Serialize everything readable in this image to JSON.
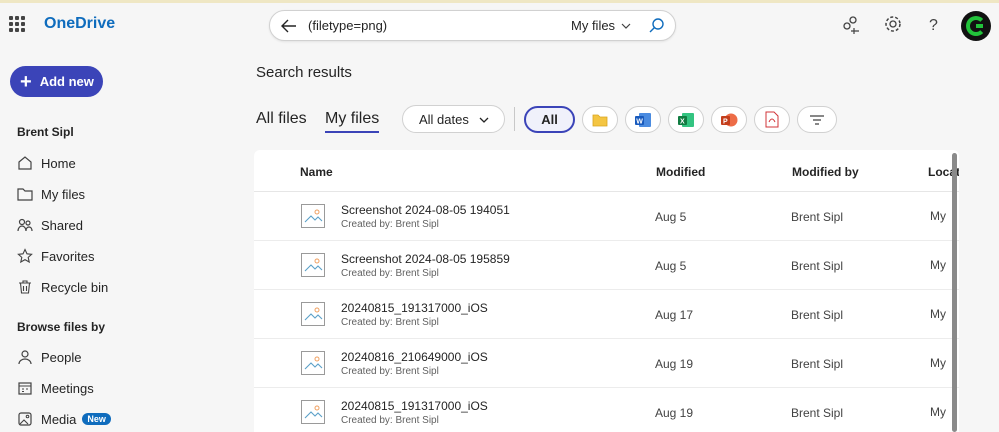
{
  "app": {
    "brand": "OneDrive"
  },
  "search": {
    "query": "(filetype=png)",
    "scope": "My files"
  },
  "sidebar": {
    "add_new": "Add new",
    "user_name": "Brent Sipl",
    "items": [
      {
        "label": "Home",
        "icon": "home-icon"
      },
      {
        "label": "My files",
        "icon": "folder-icon"
      },
      {
        "label": "Shared",
        "icon": "people-icon"
      },
      {
        "label": "Favorites",
        "icon": "star-icon"
      },
      {
        "label": "Recycle bin",
        "icon": "trash-icon"
      }
    ],
    "browse_title": "Browse files by",
    "browse_items": [
      {
        "label": "People",
        "icon": "person-icon"
      },
      {
        "label": "Meetings",
        "icon": "calendar-icon"
      },
      {
        "label": "Media",
        "icon": "image-icon",
        "badge": "New"
      }
    ]
  },
  "main": {
    "title": "Search results",
    "tabs": [
      {
        "label": "All files",
        "active": false
      },
      {
        "label": "My files",
        "active": true
      }
    ],
    "date_filter": "All dates",
    "filter_chips": {
      "all": "All",
      "icons": [
        "folder-icon",
        "word-icon",
        "excel-icon",
        "powerpoint-icon",
        "pdf-icon",
        "filter-icon"
      ]
    }
  },
  "table": {
    "columns": [
      "Name",
      "Modified",
      "Modified by",
      "Location"
    ],
    "rows": [
      {
        "name": "Screenshot 2024-08-05 194051",
        "creator": "Created by: Brent Sipl",
        "modified": "Aug 5",
        "modified_by": "Brent Sipl",
        "location": "My"
      },
      {
        "name": "Screenshot 2024-08-05 195859",
        "creator": "Created by: Brent Sipl",
        "modified": "Aug 5",
        "modified_by": "Brent Sipl",
        "location": "My"
      },
      {
        "name": "20240815_191317000_iOS",
        "creator": "Created by: Brent Sipl",
        "modified": "Aug 17",
        "modified_by": "Brent Sipl",
        "location": "My"
      },
      {
        "name": "20240816_210649000_iOS",
        "creator": "Created by: Brent Sipl",
        "modified": "Aug 19",
        "modified_by": "Brent Sipl",
        "location": "My"
      },
      {
        "name": "20240815_191317000_iOS",
        "creator": "Created by: Brent Sipl",
        "modified": "Aug 19",
        "modified_by": "Brent Sipl",
        "location": "My"
      }
    ]
  },
  "colors": {
    "accent": "#3b44b8",
    "brand": "#0f6cbd",
    "avatar_ring": "#22c33b"
  }
}
